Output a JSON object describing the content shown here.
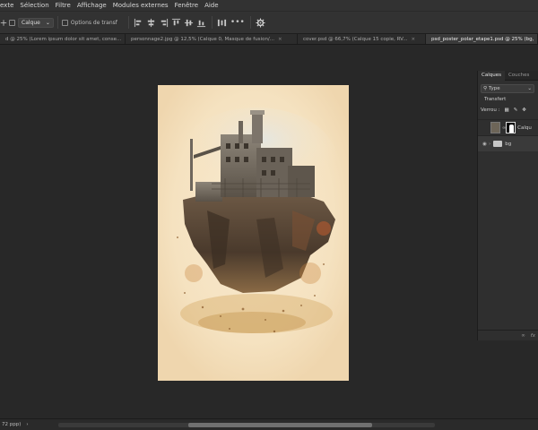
{
  "menubar": {
    "items": [
      "exte",
      "Sélection",
      "Filtre",
      "Affichage",
      "Modules externes",
      "Fenêtre",
      "Aide"
    ]
  },
  "options": {
    "layer_dropdown": "Calque",
    "transform_option": "Options de transf",
    "more_label": "•••"
  },
  "tabs": [
    {
      "label": "d @ 25% (Lorem ipsum dolor sit amet, conse...",
      "active": false
    },
    {
      "label": "personnage2.jpg @ 12,5% (Calque 0, Masque de fusion/...",
      "active": false
    },
    {
      "label": "cover.psd @ 66,7% (Calque 15 copie, RV...",
      "active": false
    },
    {
      "label": "psd_poster_polar_etape1.psd @ 25% (bg,",
      "active": true
    }
  ],
  "panel": {
    "tabs": [
      "Calques",
      "Couches"
    ],
    "filter_label": "Type",
    "blend_mode": "Transfert",
    "lock_label": "Verrou :",
    "layers": [
      {
        "name": "Calqu",
        "selected": false
      },
      {
        "name": "bg",
        "selected": true
      }
    ],
    "footer_fx": "fx"
  },
  "status": {
    "zoom_text": "72 ppp)"
  },
  "colors": {
    "poster_bg": "#f6e4c4",
    "app_bg": "#282828",
    "panel_bg": "#2f2f2f"
  }
}
